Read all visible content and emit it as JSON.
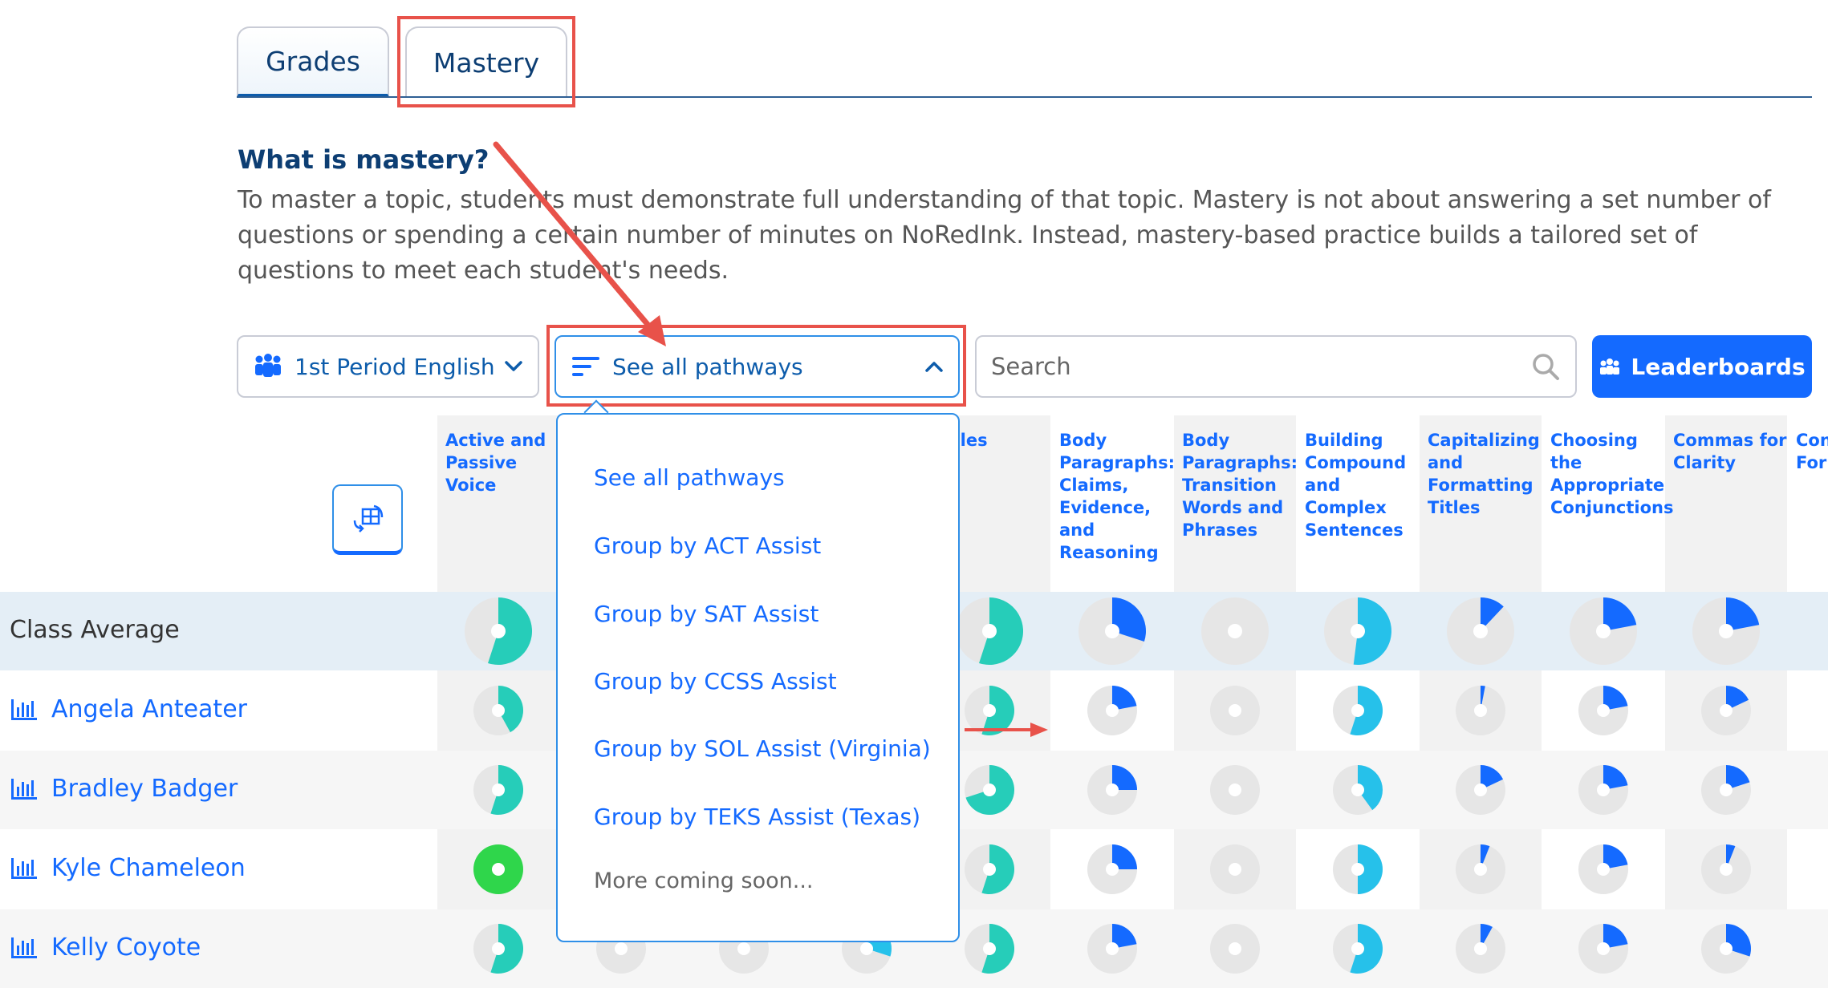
{
  "tabs": [
    {
      "label": "Grades",
      "active": false
    },
    {
      "label": "Mastery",
      "active": true
    }
  ],
  "mastery": {
    "title": "What is mastery?",
    "description": "To master a topic, students must demonstrate full understanding of that topic. Mastery is not about answering a set number of questions or spending a certain number of minutes on NoRedInk. Instead, mastery-based practice builds a tailored set of questions to meet each student's needs."
  },
  "controls": {
    "class_select": {
      "value": "1st Period English",
      "icon": "people-icon"
    },
    "pathway_select": {
      "value": "See all pathways",
      "icon": "filter-lines-icon",
      "open": true
    },
    "search": {
      "placeholder": "Search"
    },
    "leaderboards_label": "Leaderboards"
  },
  "pathway_options": [
    "See all pathways",
    "Group by ACT Assist",
    "Group by SAT Assist",
    "Group by CCSS Assist",
    "Group by SOL Assist (Virginia)",
    "Group by TEKS Assist (Texas)"
  ],
  "pathway_coming_soon": "More coming soon...",
  "topics": [
    {
      "lines": [
        "Active and",
        "Passive",
        "Voice"
      ]
    },
    {
      "lines": [
        ""
      ]
    },
    {
      "lines": [
        ""
      ]
    },
    {
      "lines": [
        ""
      ]
    },
    {
      "lines": [
        "ticles"
      ]
    },
    {
      "lines": [
        "Body",
        "Paragraphs:",
        "Claims,",
        "Evidence,",
        "and",
        "Reasoning"
      ]
    },
    {
      "lines": [
        "Body",
        "Paragraphs:",
        "Transition",
        "Words and",
        "Phrases"
      ]
    },
    {
      "lines": [
        "Building",
        "Compound",
        "and Complex",
        "Sentences"
      ]
    },
    {
      "lines": [
        "Capitalizing",
        "and",
        "Formatting",
        "Titles"
      ]
    },
    {
      "lines": [
        "Choosing",
        "the",
        "Appropriate",
        "Conjunctions"
      ]
    },
    {
      "lines": [
        "Commas for",
        "Clarity"
      ]
    },
    {
      "lines": [
        "Con",
        "For"
      ]
    }
  ],
  "rows": [
    {
      "name": "Class Average",
      "type": "average",
      "progress": [
        0.55,
        0,
        0,
        0,
        0.55,
        0.3,
        0,
        0.52,
        0.12,
        0.22,
        0.22,
        0
      ]
    },
    {
      "name": "Angela Anteater",
      "type": "student",
      "progress": [
        0.42,
        0,
        0,
        0,
        0.55,
        0.22,
        0,
        0.55,
        0.03,
        0.22,
        0.18,
        0
      ]
    },
    {
      "name": "Bradley Badger",
      "type": "student",
      "progress": [
        0.55,
        0,
        0,
        0,
        0.7,
        0.25,
        0,
        0.4,
        0.18,
        0.22,
        0.2,
        0
      ]
    },
    {
      "name": "Kyle Chameleon",
      "type": "student",
      "progress": [
        1.0,
        0,
        0,
        0,
        0.55,
        0.25,
        0,
        0.5,
        0.06,
        0.22,
        0.06,
        0
      ]
    },
    {
      "name": "Kelly Coyote",
      "type": "student",
      "progress": [
        0.55,
        0,
        0,
        0.3,
        0.55,
        0.22,
        0,
        0.55,
        0.08,
        0.22,
        0.3,
        0
      ]
    }
  ],
  "colors": {
    "teal": "#26cdb9",
    "cyan": "#26c1ea",
    "blue": "#146aff",
    "green": "#2fd64b",
    "empty": "#e6e6e6",
    "highlight": "#e8524a"
  }
}
